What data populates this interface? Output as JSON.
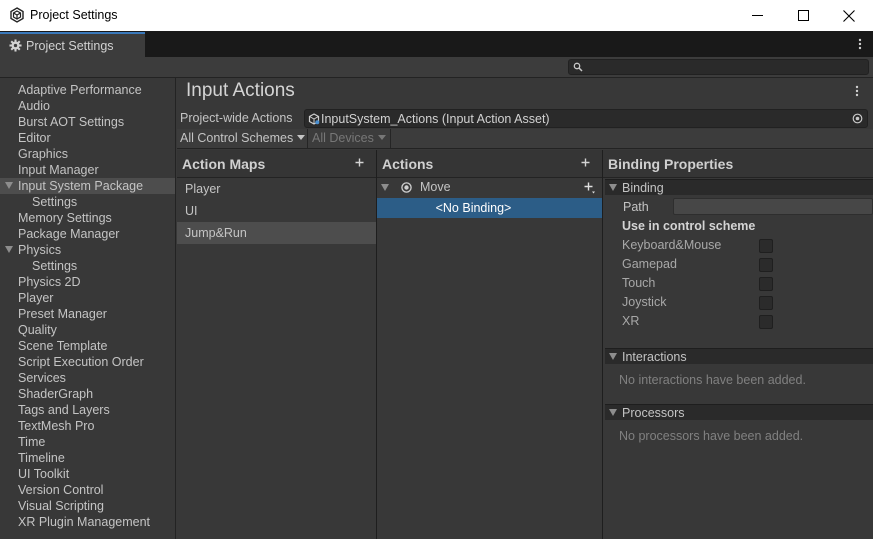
{
  "window": {
    "title": "Project Settings",
    "tab_label": "Project Settings",
    "search_placeholder": ""
  },
  "sidebar": {
    "items": [
      {
        "label": "Adaptive Performance",
        "level": 0
      },
      {
        "label": "Audio",
        "level": 0
      },
      {
        "label": "Burst AOT Settings",
        "level": 0
      },
      {
        "label": "Editor",
        "level": 0
      },
      {
        "label": "Graphics",
        "level": 0
      },
      {
        "label": "Input Manager",
        "level": 0
      },
      {
        "label": "Input System Package",
        "level": 0,
        "expanded": true,
        "selected": true
      },
      {
        "label": "Settings",
        "level": 1
      },
      {
        "label": "Memory Settings",
        "level": 0
      },
      {
        "label": "Package Manager",
        "level": 0
      },
      {
        "label": "Physics",
        "level": 0,
        "expanded": true
      },
      {
        "label": "Settings",
        "level": 1
      },
      {
        "label": "Physics 2D",
        "level": 0
      },
      {
        "label": "Player",
        "level": 0
      },
      {
        "label": "Preset Manager",
        "level": 0
      },
      {
        "label": "Quality",
        "level": 0
      },
      {
        "label": "Scene Template",
        "level": 0
      },
      {
        "label": "Script Execution Order",
        "level": 0
      },
      {
        "label": "Services",
        "level": 0
      },
      {
        "label": "ShaderGraph",
        "level": 0
      },
      {
        "label": "Tags and Layers",
        "level": 0
      },
      {
        "label": "TextMesh Pro",
        "level": 0
      },
      {
        "label": "Time",
        "level": 0
      },
      {
        "label": "Timeline",
        "level": 0
      },
      {
        "label": "UI Toolkit",
        "level": 0
      },
      {
        "label": "Version Control",
        "level": 0
      },
      {
        "label": "Visual Scripting",
        "level": 0
      },
      {
        "label": "XR Plugin Management",
        "level": 0
      }
    ]
  },
  "main": {
    "title": "Input Actions",
    "project_wide_label": "Project-wide Actions",
    "project_wide_value": "InputSystem_Actions (Input Action Asset)",
    "control_schemes_label": "All Control Schemes",
    "devices_label": "All Devices"
  },
  "action_maps": {
    "title": "Action Maps",
    "items": [
      "Player",
      "UI",
      "Jump&Run"
    ],
    "selected_index": 2
  },
  "actions": {
    "title": "Actions",
    "action_name": "Move",
    "binding_label": "<No Binding>"
  },
  "binding_properties": {
    "title": "Binding Properties",
    "binding_section": "Binding",
    "path_label": "Path",
    "path_value": "",
    "use_in_scheme_label": "Use in control scheme",
    "schemes": [
      {
        "label": "Keyboard&Mouse",
        "checked": false
      },
      {
        "label": "Gamepad",
        "checked": false
      },
      {
        "label": "Touch",
        "checked": false
      },
      {
        "label": "Joystick",
        "checked": false
      },
      {
        "label": "XR",
        "checked": false
      }
    ],
    "interactions_section": "Interactions",
    "interactions_empty": "No interactions have been added.",
    "processors_section": "Processors",
    "processors_empty": "No processors have been added."
  },
  "colors": {
    "accent_tab": "#3a79bb",
    "selection_blue": "#2c5d87",
    "panel_bg": "#383838"
  }
}
